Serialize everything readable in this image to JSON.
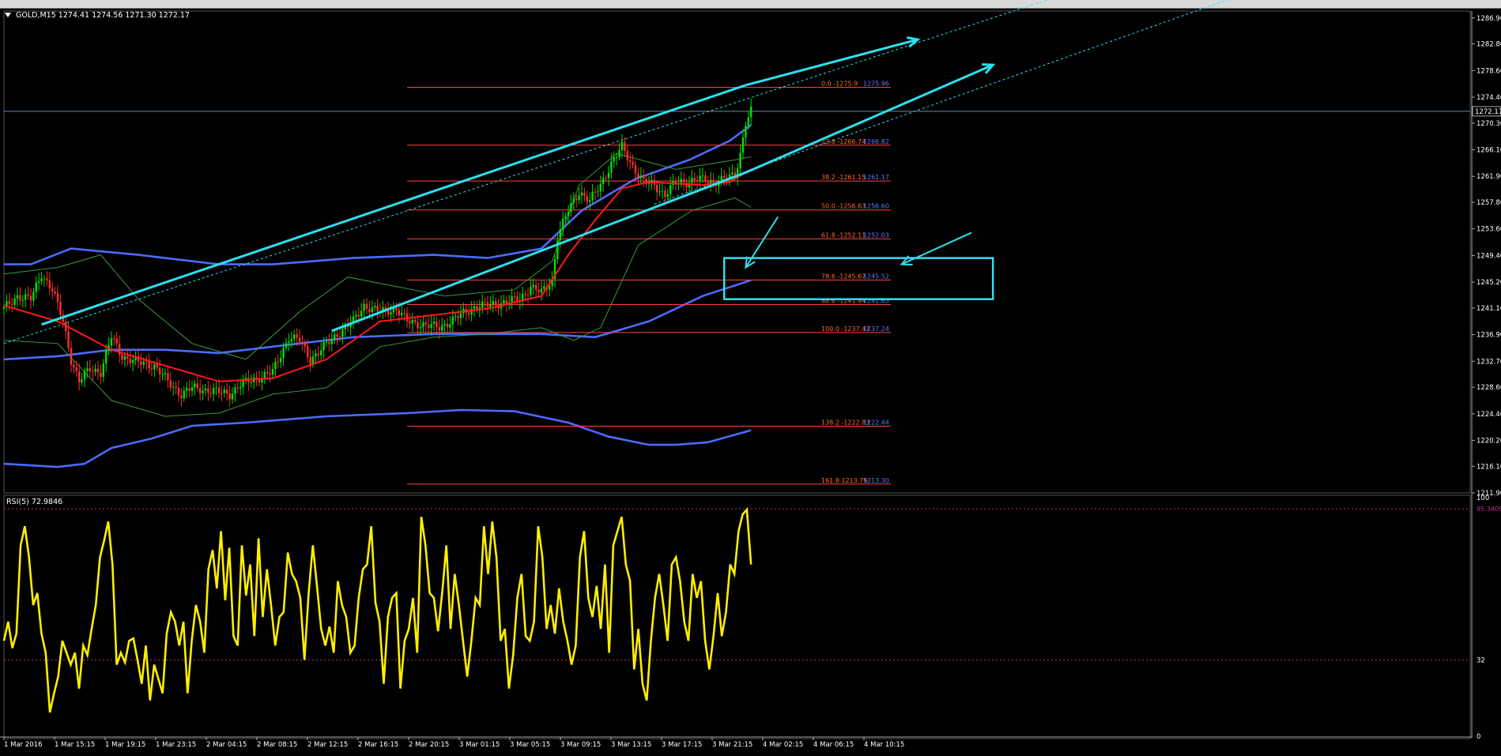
{
  "window": {
    "header_text": "GOLD,M15  1274.41 1274.56 1271.30 1272.17",
    "header_menu_icon": "triangle-down-icon"
  },
  "colors": {
    "background": "#000000",
    "candle_up": "#00e000",
    "candle_down": "#ff3030",
    "channel_line": "#2ce0ee",
    "bollinger_outer": "#4a6cff",
    "bollinger_inner": "#3a9a3a",
    "moving_average": "#ff1a1a",
    "fib_line": "#ff4040",
    "fib_label": "#ff6b2d",
    "fib_price_label": "#5c7cff",
    "rsi_line": "#ffee00",
    "rsi_level": "#c0308c",
    "current_price_line": "#6a8aa0",
    "axis_text": "#ffffff"
  },
  "chart_data": [
    {
      "type": "candlestick",
      "symbol": "GOLD",
      "timeframe": "M15",
      "header": {
        "open": 1274.41,
        "high": 1274.56,
        "low": 1271.3,
        "close": 1272.17
      },
      "current_price": 1272.17,
      "ylim": [
        1211.9,
        1288.0
      ],
      "y_ticks": [
        1286.9,
        1282.8,
        1278.6,
        1274.4,
        1270.3,
        1266.1,
        1261.9,
        1257.8,
        1253.6,
        1249.4,
        1245.2,
        1241.1,
        1236.9,
        1232.7,
        1228.6,
        1224.4,
        1220.2,
        1216.1,
        1211.9
      ],
      "y_tick_labels": [
        "1286.90",
        "1282.80",
        "1278.60",
        "1274.40",
        "1270.30",
        "1266.10",
        "1261.90",
        "1257.80",
        "1253.60",
        "1249.40",
        "1245.20",
        "1241.10",
        "1236.90",
        "1232.70",
        "1228.60",
        "1224.40",
        "1220.20",
        "1216.10",
        "1211.90"
      ],
      "x_labels": [
        "1 Mar 2016",
        "1 Mar 15:15",
        "1 Mar 19:15",
        "1 Mar 23:15",
        "2 Mar 04:15",
        "2 Mar 08:15",
        "2 Mar 12:15",
        "2 Mar 16:15",
        "2 Mar 20:15",
        "3 Mar 01:15",
        "3 Mar 05:15",
        "3 Mar 09:15",
        "3 Mar 13:15",
        "3 Mar 17:15",
        "3 Mar 21:15",
        "4 Mar 02:15",
        "4 Mar 06:15",
        "4 Mar 10:15"
      ],
      "price_path": [
        [
          0,
          1241.0
        ],
        [
          5,
          1243.0
        ],
        [
          10,
          1242.5
        ],
        [
          14,
          1246.5
        ],
        [
          18,
          1244.0
        ],
        [
          22,
          1239.0
        ],
        [
          25,
          1233.0
        ],
        [
          28,
          1229.5
        ],
        [
          32,
          1231.5
        ],
        [
          36,
          1231.0
        ],
        [
          40,
          1236.5
        ],
        [
          44,
          1233.5
        ],
        [
          50,
          1232.5
        ],
        [
          56,
          1232.0
        ],
        [
          62,
          1229.0
        ],
        [
          66,
          1227.5
        ],
        [
          70,
          1228.5
        ],
        [
          78,
          1228.0
        ],
        [
          84,
          1227.5
        ],
        [
          88,
          1229.0
        ],
        [
          94,
          1230.0
        ],
        [
          100,
          1231.0
        ],
        [
          106,
          1236.5
        ],
        [
          110,
          1236.0
        ],
        [
          114,
          1233.0
        ],
        [
          118,
          1234.5
        ],
        [
          124,
          1237.0
        ],
        [
          130,
          1239.0
        ],
        [
          134,
          1241.5
        ],
        [
          140,
          1240.5
        ],
        [
          146,
          1241.0
        ],
        [
          150,
          1239.0
        ],
        [
          156,
          1238.5
        ],
        [
          162,
          1238.0
        ],
        [
          168,
          1239.5
        ],
        [
          172,
          1240.5
        ],
        [
          176,
          1241.5
        ],
        [
          180,
          1241.5
        ],
        [
          186,
          1242.0
        ],
        [
          192,
          1242.5
        ],
        [
          196,
          1244.5
        ],
        [
          200,
          1243.5
        ],
        [
          204,
          1245.5
        ],
        [
          206,
          1252.5
        ],
        [
          210,
          1256.5
        ],
        [
          214,
          1259.5
        ],
        [
          218,
          1258.0
        ],
        [
          222,
          1260.5
        ],
        [
          226,
          1264.0
        ],
        [
          230,
          1266.5
        ],
        [
          234,
          1263.5
        ],
        [
          238,
          1261.0
        ],
        [
          242,
          1260.5
        ],
        [
          246,
          1259.0
        ],
        [
          250,
          1261.0
        ],
        [
          254,
          1261.0
        ],
        [
          258,
          1261.5
        ],
        [
          264,
          1261.0
        ],
        [
          268,
          1261.5
        ],
        [
          272,
          1262.0
        ],
        [
          274,
          1265.5
        ],
        [
          276,
          1270.5
        ],
        [
          278,
          1272.2
        ]
      ],
      "moving_average": [
        [
          0,
          1241.5
        ],
        [
          20,
          1239.0
        ],
        [
          40,
          1234.5
        ],
        [
          60,
          1232.0
        ],
        [
          80,
          1229.5
        ],
        [
          100,
          1230.0
        ],
        [
          120,
          1233.0
        ],
        [
          140,
          1239.0
        ],
        [
          160,
          1240.0
        ],
        [
          180,
          1241.0
        ],
        [
          200,
          1243.0
        ],
        [
          210,
          1249.5
        ],
        [
          220,
          1255.0
        ],
        [
          230,
          1260.0
        ],
        [
          240,
          1261.0
        ],
        [
          260,
          1260.5
        ],
        [
          270,
          1261.0
        ],
        [
          278,
          1263.0
        ]
      ],
      "bollinger_inner_upper": [
        [
          0,
          1246.5
        ],
        [
          20,
          1247.5
        ],
        [
          36,
          1249.5
        ],
        [
          50,
          1242.5
        ],
        [
          70,
          1235.5
        ],
        [
          90,
          1233.0
        ],
        [
          110,
          1240.5
        ],
        [
          128,
          1246.0
        ],
        [
          146,
          1244.5
        ],
        [
          164,
          1243.0
        ],
        [
          190,
          1244.0
        ],
        [
          204,
          1248.5
        ],
        [
          214,
          1260.5
        ],
        [
          228,
          1265.5
        ],
        [
          250,
          1263.0
        ],
        [
          272,
          1264.5
        ],
        [
          278,
          1265.0
        ]
      ],
      "bollinger_inner_lower": [
        [
          0,
          1236.0
        ],
        [
          20,
          1235.5
        ],
        [
          40,
          1226.5
        ],
        [
          60,
          1224.0
        ],
        [
          80,
          1224.5
        ],
        [
          100,
          1227.5
        ],
        [
          120,
          1228.5
        ],
        [
          140,
          1235.0
        ],
        [
          160,
          1236.5
        ],
        [
          180,
          1237.0
        ],
        [
          200,
          1238.0
        ],
        [
          212,
          1236.0
        ],
        [
          222,
          1238.0
        ],
        [
          236,
          1251.0
        ],
        [
          256,
          1256.5
        ],
        [
          272,
          1258.5
        ],
        [
          278,
          1257.0
        ]
      ],
      "bollinger_outer_upper": [
        [
          0,
          1248.0
        ],
        [
          10,
          1248.0
        ],
        [
          25,
          1250.5
        ],
        [
          50,
          1249.5
        ],
        [
          80,
          1248.0
        ],
        [
          100,
          1248.0
        ],
        [
          130,
          1249.0
        ],
        [
          160,
          1249.5
        ],
        [
          180,
          1249.0
        ],
        [
          200,
          1250.5
        ],
        [
          215,
          1256.5
        ],
        [
          235,
          1261.5
        ],
        [
          255,
          1264.5
        ],
        [
          270,
          1267.5
        ],
        [
          278,
          1270.0
        ]
      ],
      "bollinger_outer_lower": [
        [
          0,
          1216.5
        ],
        [
          20,
          1216.0
        ],
        [
          30,
          1216.5
        ],
        [
          40,
          1219.0
        ],
        [
          55,
          1220.5
        ],
        [
          70,
          1222.5
        ],
        [
          90,
          1223.0
        ],
        [
          120,
          1224.0
        ],
        [
          150,
          1224.5
        ],
        [
          170,
          1225.0
        ],
        [
          190,
          1224.8
        ],
        [
          210,
          1223.0
        ],
        [
          225,
          1220.8
        ],
        [
          240,
          1219.5
        ],
        [
          250,
          1219.5
        ],
        [
          262,
          1219.9
        ],
        [
          278,
          1221.8
        ]
      ],
      "bollinger_outer_middle": [
        [
          0,
          1233.0
        ],
        [
          20,
          1233.5
        ],
        [
          40,
          1234.5
        ],
        [
          60,
          1234.5
        ],
        [
          80,
          1234.0
        ],
        [
          100,
          1235.0
        ],
        [
          130,
          1236.5
        ],
        [
          160,
          1237.0
        ],
        [
          200,
          1237.0
        ],
        [
          220,
          1236.5
        ],
        [
          240,
          1239.0
        ],
        [
          260,
          1243.0
        ],
        [
          278,
          1245.5
        ]
      ],
      "fibonacci": {
        "levels": [
          {
            "ratio": "0.0",
            "price": 1275.96,
            "label": "0.0  -1275.9",
            "price_label": "1275.96"
          },
          {
            "ratio": "23.6",
            "price": 1266.82,
            "label": "23.6  -1266.74",
            "price_label": "1266.82"
          },
          {
            "ratio": "38.2",
            "price": 1261.17,
            "label": "38.2  -1261.15",
            "price_label": "1261.17"
          },
          {
            "ratio": "50.0",
            "price": 1256.6,
            "label": "50.0  -1256.63",
            "price_label": "1256.60"
          },
          {
            "ratio": "61.8",
            "price": 1252.03,
            "label": "61.8  -1252.11",
            "price_label": "1252.03"
          },
          {
            "ratio": "78.6",
            "price": 1245.52,
            "label": "78.6  -1245.67",
            "price_label": "1245.52"
          },
          {
            "ratio": "88.6",
            "price": 1241.65,
            "label": "88.6  -1241.84",
            "price_label": "1241.65"
          },
          {
            "ratio": "100.0",
            "price": 1237.24,
            "label": "100.0  -1237.47",
            "price_label": "1237.24"
          },
          {
            "ratio": "138.2",
            "price": 1222.44,
            "label": "138.2  -1222.83",
            "price_label": "1222.44"
          },
          {
            "ratio": "161.8",
            "price": 1213.3,
            "label": "161.8  1213.79",
            "price_label": "1213.30"
          }
        ]
      },
      "channel": {
        "upper": [
          [
            14,
            1238.5
          ],
          [
            276,
            1276.3
          ]
        ],
        "lower": [
          [
            122,
            1237.5
          ],
          [
            276,
            1262.5
          ]
        ],
        "upper_arrow_end": [
          [
            276,
            1276.3
          ],
          [
            340,
            1283.5
          ]
        ],
        "lower_arrow_end": [
          [
            276,
            1262.5
          ],
          [
            368,
            1279.5
          ]
        ],
        "zone_box": {
          "x_from": 268,
          "x_to": 368,
          "price_top": 1249.0,
          "price_bottom": 1242.5
        },
        "pointer_arrows": [
          {
            "from": [
              288,
              1255.5
            ],
            "to": [
              276,
              1247.5
            ]
          },
          {
            "from": [
              360,
              1253.0
            ],
            "to": [
              334,
              1248.0
            ]
          }
        ]
      },
      "dotted_trendlines": [
        {
          "from": [
            0,
            1235.5
          ],
          "to": [
            390,
            1290.0
          ]
        },
        {
          "from": [
            242,
            1257.5
          ],
          "to": [
            460,
            1290.5
          ]
        }
      ]
    },
    {
      "type": "line",
      "indicator": "RSI(5)",
      "header_text": "RSI(5) 72.9846",
      "current_value": 72.9846,
      "ylim": [
        0,
        100
      ],
      "levels": [
        {
          "value": 95.3409,
          "label": "95.3409"
        },
        {
          "value": 32,
          "label": "32"
        }
      ],
      "y_tick_labels": [
        "100",
        "32",
        "0"
      ],
      "values": [
        40,
        48,
        37,
        43,
        80,
        88,
        75,
        55,
        60,
        43,
        35,
        10,
        18,
        25,
        40,
        35,
        30,
        35,
        20,
        38,
        34,
        45,
        55,
        75,
        82,
        90,
        72,
        30,
        35,
        31,
        40,
        41,
        32,
        22,
        38,
        15,
        30,
        24,
        18,
        43,
        52,
        48,
        38,
        48,
        18,
        40,
        55,
        48,
        35,
        70,
        78,
        62,
        86,
        57,
        79,
        42,
        38,
        80,
        59,
        72,
        42,
        83,
        50,
        70,
        55,
        38,
        50,
        52,
        77,
        68,
        65,
        58,
        32,
        60,
        80,
        63,
        45,
        38,
        46,
        35,
        65,
        55,
        50,
        35,
        38,
        58,
        70,
        72,
        88,
        56,
        48,
        22,
        50,
        58,
        60,
        20,
        40,
        45,
        58,
        35,
        92,
        80,
        60,
        58,
        44,
        60,
        80,
        45,
        68,
        55,
        40,
        25,
        40,
        58,
        55,
        88,
        68,
        90,
        75,
        40,
        45,
        20,
        34,
        58,
        68,
        42,
        40,
        48,
        88,
        75,
        45,
        55,
        43,
        62,
        48,
        40,
        30,
        38,
        75,
        86,
        58,
        50,
        63,
        45,
        72,
        35,
        80,
        86,
        92,
        72,
        65,
        28,
        45,
        22,
        15,
        40,
        58,
        68,
        55,
        40,
        72,
        75,
        65,
        48,
        40,
        68,
        58,
        65,
        40,
        28,
        42,
        60,
        42,
        52,
        72,
        68,
        86,
        93,
        95,
        72
      ]
    }
  ]
}
